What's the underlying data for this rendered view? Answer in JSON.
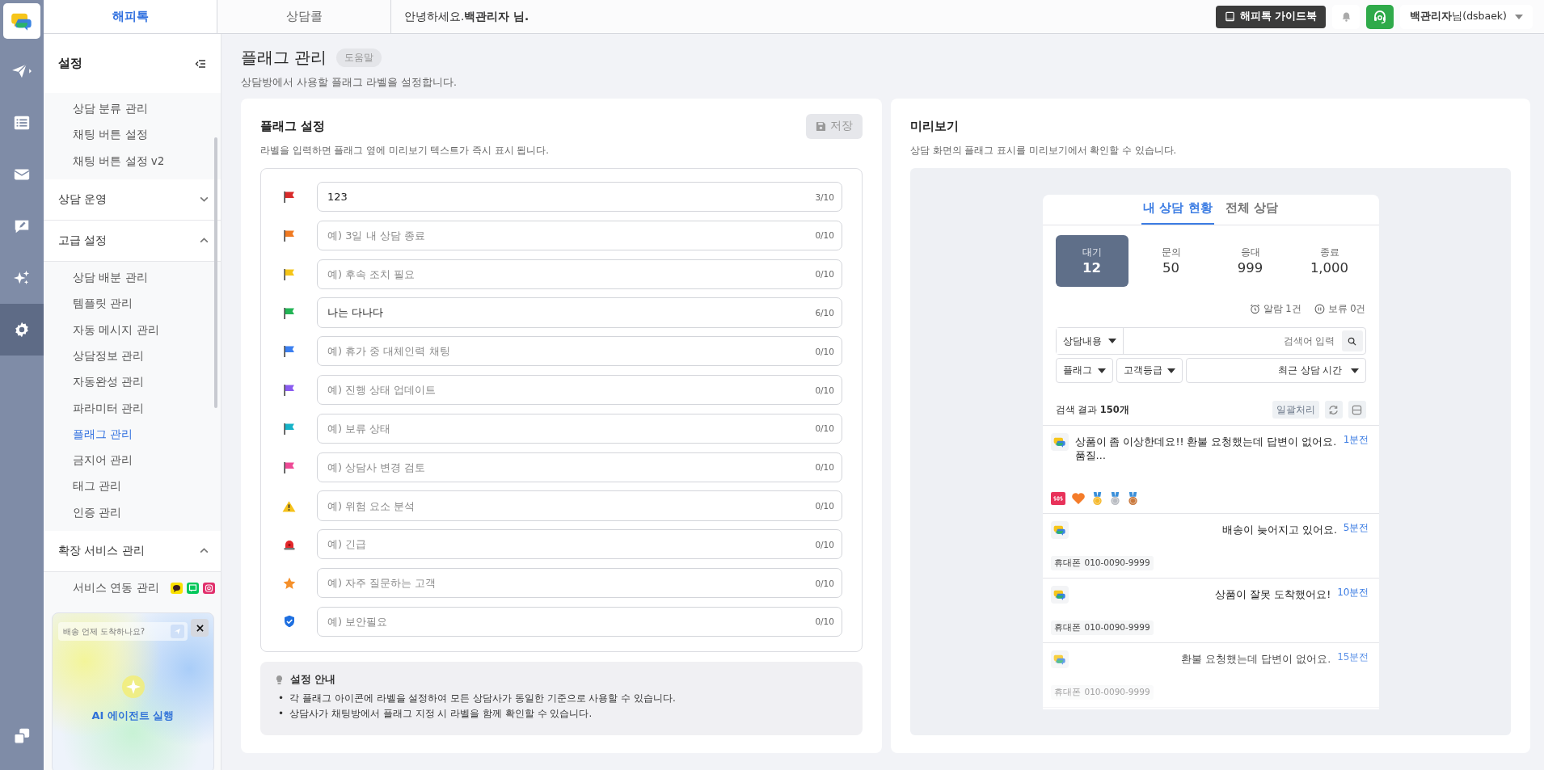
{
  "rail": {
    "items": [
      {
        "selected": false
      },
      {
        "selected": false
      },
      {
        "selected": false
      },
      {
        "selected": false
      },
      {
        "selected": false
      },
      {
        "selected": true
      },
      {
        "selected": false
      }
    ]
  },
  "top_tabs": [
    {
      "label": "해피톡",
      "selected": true
    },
    {
      "label": "상담콜",
      "selected": false
    }
  ],
  "greeting": "안녕하세요.**백관리자 님.**",
  "guide_button": "해피톡 가이드북",
  "user_menu": "**백관리자**님(dsbaek)",
  "sidebar": {
    "title": "설정",
    "groups": [
      {
        "items": [
          {
            "label": "상담 분류 관리",
            "selected": false
          },
          {
            "label": "채팅 버튼 설정",
            "selected": false
          },
          {
            "label": "채팅 버튼 설정 v2",
            "selected": false
          }
        ]
      },
      {
        "title": "상담 운영",
        "expanded": false
      },
      {
        "title": "고급 설정",
        "expanded": true,
        "items": [
          {
            "label": "상담 배분 관리",
            "selected": false
          },
          {
            "label": "템플릿 관리",
            "selected": false
          },
          {
            "label": "자동 메시지 관리",
            "selected": false
          },
          {
            "label": "상담정보 관리",
            "selected": false
          },
          {
            "label": "자동완성 관리",
            "selected": false
          },
          {
            "label": "파라미터 관리",
            "selected": false
          },
          {
            "label": "플래그 관리",
            "selected": true
          },
          {
            "label": "금지어 관리",
            "selected": false
          },
          {
            "label": "태그 관리",
            "selected": false
          },
          {
            "label": "인증 관리",
            "selected": false
          }
        ]
      },
      {
        "title": "확장 서비스 관리",
        "expanded": true,
        "items": [
          {
            "label": "서비스 연동 관리",
            "selected": false,
            "kind": "services"
          }
        ]
      }
    ]
  },
  "ai_card": {
    "placeholder": "배송 언제 도착하나요?",
    "label": "AI 에이전트 실행"
  },
  "page": {
    "title": "플래그 관리",
    "help": "도움말",
    "description": "상담방에서 사용할 플래그 라벨을 설정합니다."
  },
  "flag_settings": {
    "title": "플래그 설정",
    "save_button": {
      "label": "저장",
      "disabled": true
    },
    "description": "라벨을 입력하면 플래그 옆에 미리보기 텍스트가 즉시 표시 됩니다.",
    "rows": [
      {
        "kind": "flag",
        "color": "#d92b2b",
        "value": "123",
        "count": "3/10"
      },
      {
        "kind": "flag",
        "color": "#f07a22",
        "placeholder": "예) 3일 내 상담 종료",
        "count": "0/10"
      },
      {
        "kind": "flag",
        "color": "#f5c518",
        "placeholder": "예) 후속 조치 필요",
        "count": "0/10"
      },
      {
        "kind": "flag",
        "color": "#22b455",
        "value": "나는 다나다",
        "count": "6/10"
      },
      {
        "kind": "flag",
        "color": "#3b7ff0",
        "placeholder": "예) 휴가 중 대체인력 채팅",
        "count": "0/10"
      },
      {
        "kind": "flag",
        "color": "#8a5cf0",
        "placeholder": "예) 진행 상태 업데이트",
        "count": "0/10"
      },
      {
        "kind": "flag",
        "color": "#17b3c8",
        "placeholder": "예) 보류 상태",
        "count": "0/10"
      },
      {
        "kind": "flag",
        "color": "#ee4a96",
        "placeholder": "예) 상담사 변경 검토",
        "count": "0/10"
      },
      {
        "kind": "warning",
        "placeholder": "예) 위험 요소 분석",
        "count": "0/10"
      },
      {
        "kind": "siren",
        "placeholder": "예) 긴급",
        "count": "0/10"
      },
      {
        "kind": "star",
        "placeholder": "예) 자주 질문하는 고객",
        "count": "0/10"
      },
      {
        "kind": "shield",
        "placeholder": "예) 보안필요",
        "count": "0/10"
      }
    ],
    "guide": {
      "title": "설정 안내",
      "bullets": [
        {
          "marker": "•",
          "text": "각 플래그 아이콘에 라벨을 설정하여 모든 상담사가 동일한 기준으로 사용할 수 있습니다."
        },
        {
          "marker": "•",
          "text": "상담사가 채팅방에서 플래그 지정 시 라벨을 함께 확인할 수 있습니다."
        }
      ]
    }
  },
  "preview": {
    "title": "미리보기",
    "description": "상담 화면의 플래그 표시를 미리보기에서 확인할 수 있습니다.",
    "tabs": [
      {
        "label": "내 상담 현황",
        "selected": true
      },
      {
        "label": "전체 상담",
        "selected": false
      }
    ],
    "stats": [
      {
        "label": "대기",
        "value": "12",
        "selected": true
      },
      {
        "label": "문의",
        "value": "50",
        "selected": false
      },
      {
        "label": "응대",
        "value": "999",
        "selected": false
      },
      {
        "label": "종료",
        "value": "1,000",
        "selected": false
      }
    ],
    "alarm": "알람 1건",
    "hold": "보류 0건",
    "search_type": "상담내용",
    "search_placeholder": "검색어 입력",
    "filters": [
      "플래그",
      "고객등급",
      "최근 상담 시간"
    ],
    "result": "검색 결과 **150개**",
    "bulk_button": "일괄처리",
    "conversations": [
      {
        "kind": "badges",
        "message": "상품이 좀 이상한데요!! 환불 요청했는데 답변이 없어요. 품질…",
        "time": "1분전"
      },
      {
        "kind": "contact",
        "message": "배송이 늦어지고 있어요.",
        "time": "5분전",
        "phone_label": "휴대폰",
        "phone": "010-0090-9999"
      },
      {
        "kind": "contact",
        "message": "상품이 잘못 도착했어요!",
        "time": "10분전",
        "phone_label": "휴대폰",
        "phone": "010-0090-9999"
      },
      {
        "kind": "contact",
        "message": "환불 요청했는데 답변이 없어요.",
        "time": "15분전",
        "phone_label": "휴대폰",
        "phone": "010-0090-9999"
      }
    ]
  }
}
